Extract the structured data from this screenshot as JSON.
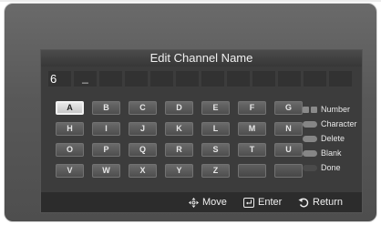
{
  "dialog": {
    "title": "Edit Channel Name"
  },
  "name_field": {
    "chars": [
      "6",
      "_",
      "",
      "",
      "",
      "",
      "",
      "",
      "",
      "",
      "",
      ""
    ]
  },
  "keyboard": {
    "selected": "A",
    "rows": [
      [
        "A",
        "B",
        "C",
        "D",
        "E",
        "F",
        "G"
      ],
      [
        "H",
        "I",
        "J",
        "K",
        "L",
        "M",
        "N"
      ],
      [
        "O",
        "P",
        "Q",
        "R",
        "S",
        "T",
        "U"
      ],
      [
        "V",
        "W",
        "X",
        "Y",
        "Z",
        "",
        ""
      ]
    ]
  },
  "legend": [
    {
      "label": "Number",
      "icon": "number-keys-icon"
    },
    {
      "label": "Character",
      "icon": "gray-button-icon"
    },
    {
      "label": "Delete",
      "icon": "gray-button-icon"
    },
    {
      "label": "Blank",
      "icon": "gray-button-icon"
    },
    {
      "label": "Done",
      "icon": "dark-button-icon"
    }
  ],
  "footer": {
    "move": "Move",
    "enter": "Enter",
    "return": "Return"
  },
  "colors": {
    "background": "#585858",
    "dialog": "#3c3c3c",
    "key": "#5c5c5c",
    "key_selected": "#d8d8d8",
    "footer": "#2c2c2c"
  }
}
